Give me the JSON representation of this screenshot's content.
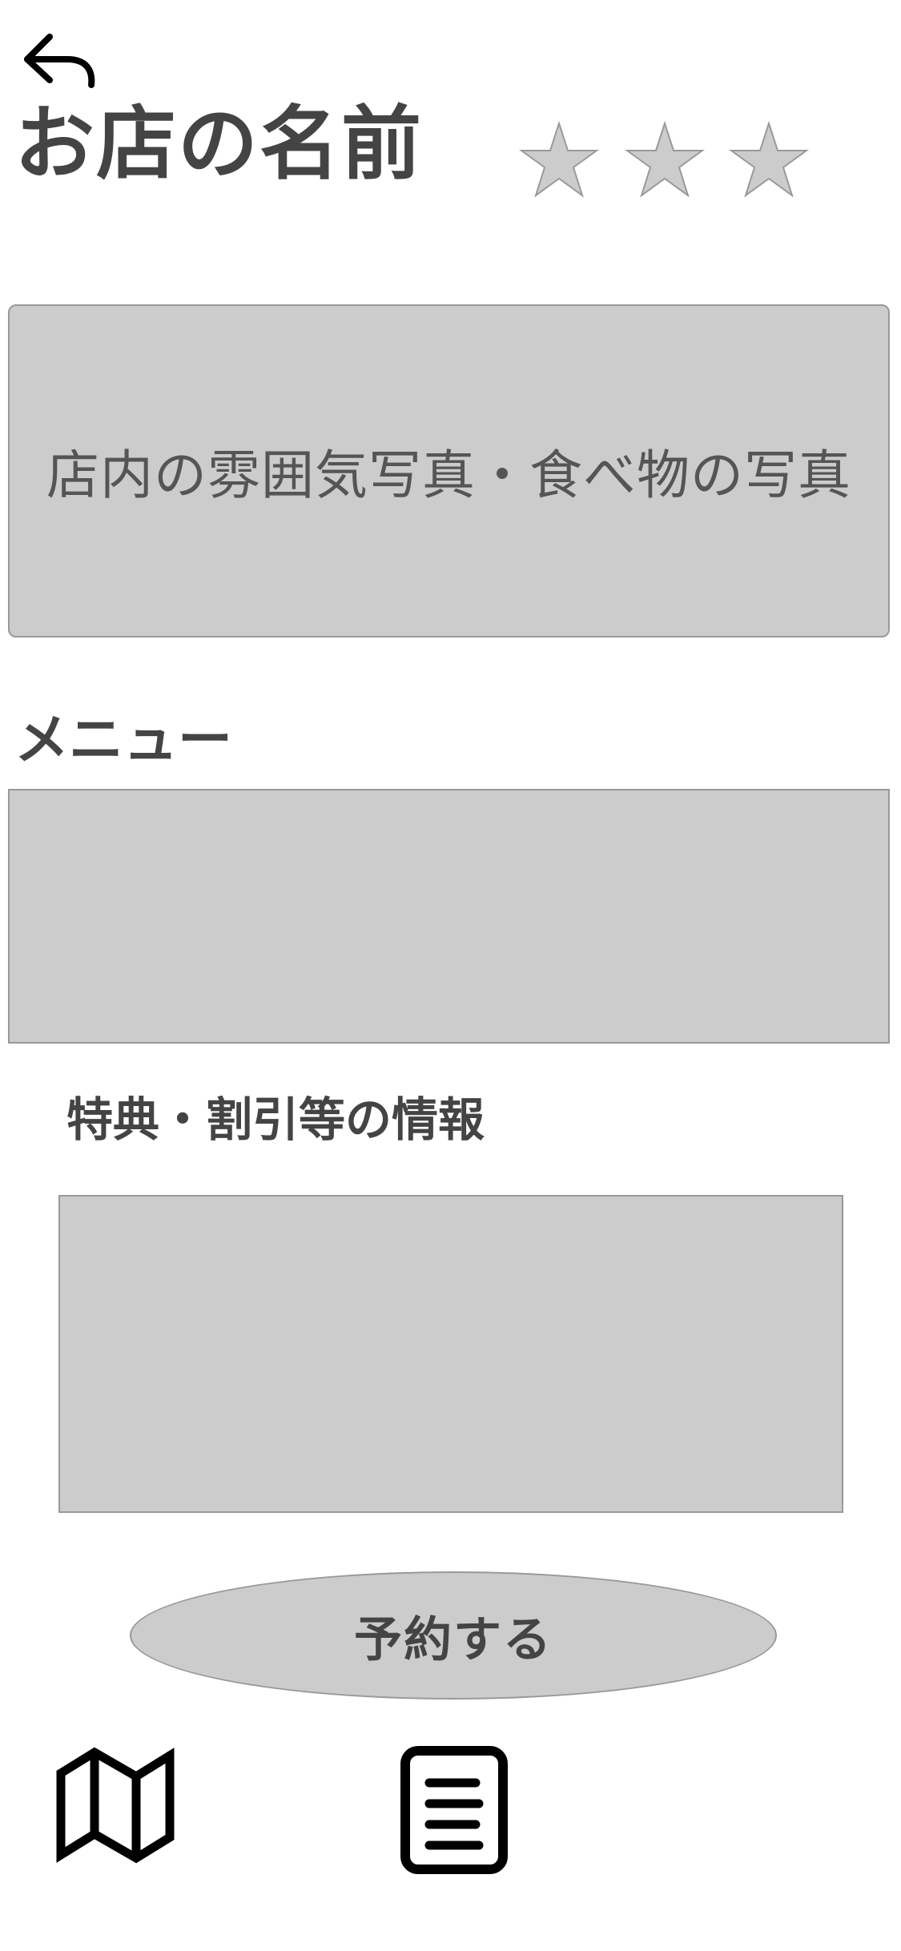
{
  "header": {
    "back_icon": "back-arrow-icon",
    "shop_name": "お店の名前",
    "rating": {
      "icon": "star-icon",
      "stars_shown": 3,
      "star_color": "#cccccc",
      "star_outline": "#999999"
    }
  },
  "photo": {
    "label": "店内の雰囲気写真・食べ物の写真"
  },
  "menu": {
    "heading": "メニュー"
  },
  "perks": {
    "heading": "特典・割引等の情報"
  },
  "reserve": {
    "label": "予約する"
  },
  "tab_bar": {
    "items": [
      {
        "icon": "map-icon"
      },
      {
        "icon": "document-icon"
      }
    ]
  },
  "colors": {
    "placeholder_fill": "#cccccc",
    "placeholder_border": "#999999",
    "text": "#444444",
    "icon": "#000000"
  }
}
